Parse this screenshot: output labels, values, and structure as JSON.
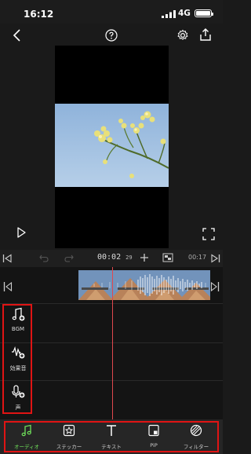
{
  "status_bar": {
    "time": "16:12",
    "network": "4G"
  },
  "timeline": {
    "current_time": "00:02",
    "current_frames": "29",
    "duration": "00:17"
  },
  "side_tools": [
    {
      "label": "BGM",
      "icon": "music-note-add-icon"
    },
    {
      "label": "効果音",
      "icon": "sound-wave-add-icon"
    },
    {
      "label": "声",
      "icon": "microphone-add-icon"
    }
  ],
  "bottom_tabs": [
    {
      "label": "オーディオ",
      "icon": "music-note-icon",
      "active": true
    },
    {
      "label": "ステッカー",
      "icon": "sticker-icon",
      "active": false
    },
    {
      "label": "テキスト",
      "icon": "text-icon",
      "active": false
    },
    {
      "label": "PiP",
      "icon": "pip-icon",
      "active": false
    },
    {
      "label": "フィルター",
      "icon": "filter-icon",
      "active": false
    }
  ],
  "colors": {
    "accent": "#6fe05a",
    "highlight_box": "#e01414",
    "playhead": "#e0484e"
  }
}
